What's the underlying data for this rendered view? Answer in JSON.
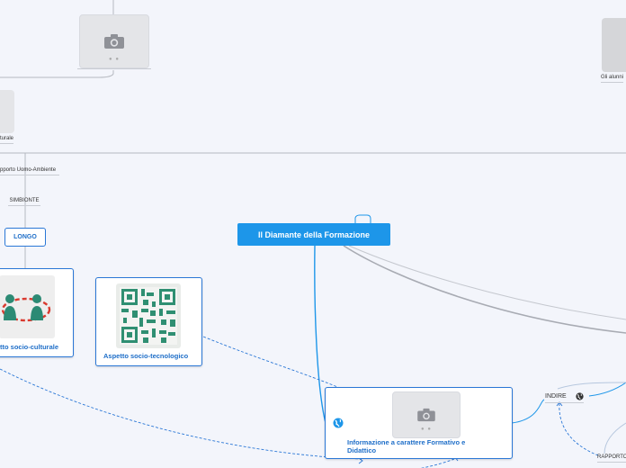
{
  "central": {
    "title": "Il Diamante della Formazione"
  },
  "labels": {
    "sociale_cut": "turale",
    "rapporto_uomo_ambiente": "pporto Uomo-Ambiente",
    "simbionte": "SIMBIONTE",
    "longo": "LONGO",
    "gli_alunni": "Gli alunni",
    "indire": "INDIRE",
    "rapporto": "RAPPORTO"
  },
  "nodes": {
    "socio_culturale": "tto socio-culturale",
    "socio_tecnologico": "Aspetto socio-tecnologico",
    "informazione": "Informazione a carattere Formativo e Didattico"
  },
  "icons": {
    "camera": "camera-icon",
    "globe": "globe-icon",
    "people": "people-icon",
    "qr": "qr-code-icon"
  },
  "colors": {
    "background": "#f3f5fb",
    "central": "#1d96e9",
    "node_border": "#2a77d6",
    "link": "#1d96e9",
    "gray_link": "#a8abb3"
  }
}
